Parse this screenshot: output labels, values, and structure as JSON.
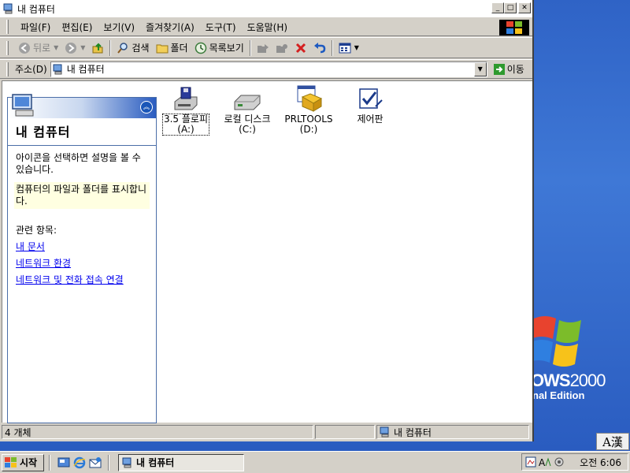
{
  "window": {
    "title": "내 컴퓨터",
    "min_label": "_",
    "max_label": "□",
    "close_label": "✕"
  },
  "menubar": {
    "items": [
      "파일(F)",
      "편집(E)",
      "보기(V)",
      "즐겨찾기(A)",
      "도구(T)",
      "도움말(H)"
    ]
  },
  "toolbar": {
    "back": "뒤로",
    "search": "검색",
    "folders": "폴더",
    "list_view": "목록보기"
  },
  "address": {
    "label": "주소(D)",
    "value": "내 컴퓨터",
    "go": "이동"
  },
  "taskpane": {
    "title": "내 컴퓨터",
    "description": "아이콘을 선택하면 설명을 볼 수 있습니다.",
    "tip": "컴퓨터의 파일과 폴더를 표시합니다.",
    "related_heading": "관련 항목:",
    "links": [
      "내 문서",
      "네트워크 환경",
      "네트워크 및 전화 접속 연결"
    ]
  },
  "drives": [
    {
      "name": "3.5 플로피",
      "letter": "(A:)",
      "icon": "floppy-drive-icon"
    },
    {
      "name": "로컬 디스크",
      "letter": "(C:)",
      "icon": "hard-disk-icon"
    },
    {
      "name": "PRLTOOLS",
      "letter": "(D:)",
      "icon": "cd-drive-icon"
    },
    {
      "name": "제어판",
      "letter": "",
      "icon": "control-panel-icon"
    }
  ],
  "statusbar": {
    "count": "4 개체",
    "location": "내 컴퓨터"
  },
  "taskbar": {
    "start": "시작",
    "task_label": "내 컴퓨터",
    "clock": "오전 6:06"
  },
  "desktop": {
    "brand_line1": "OWS",
    "brand_line1_suffix": "2000",
    "brand_line2": "nal Edition",
    "ime": "A漢"
  }
}
